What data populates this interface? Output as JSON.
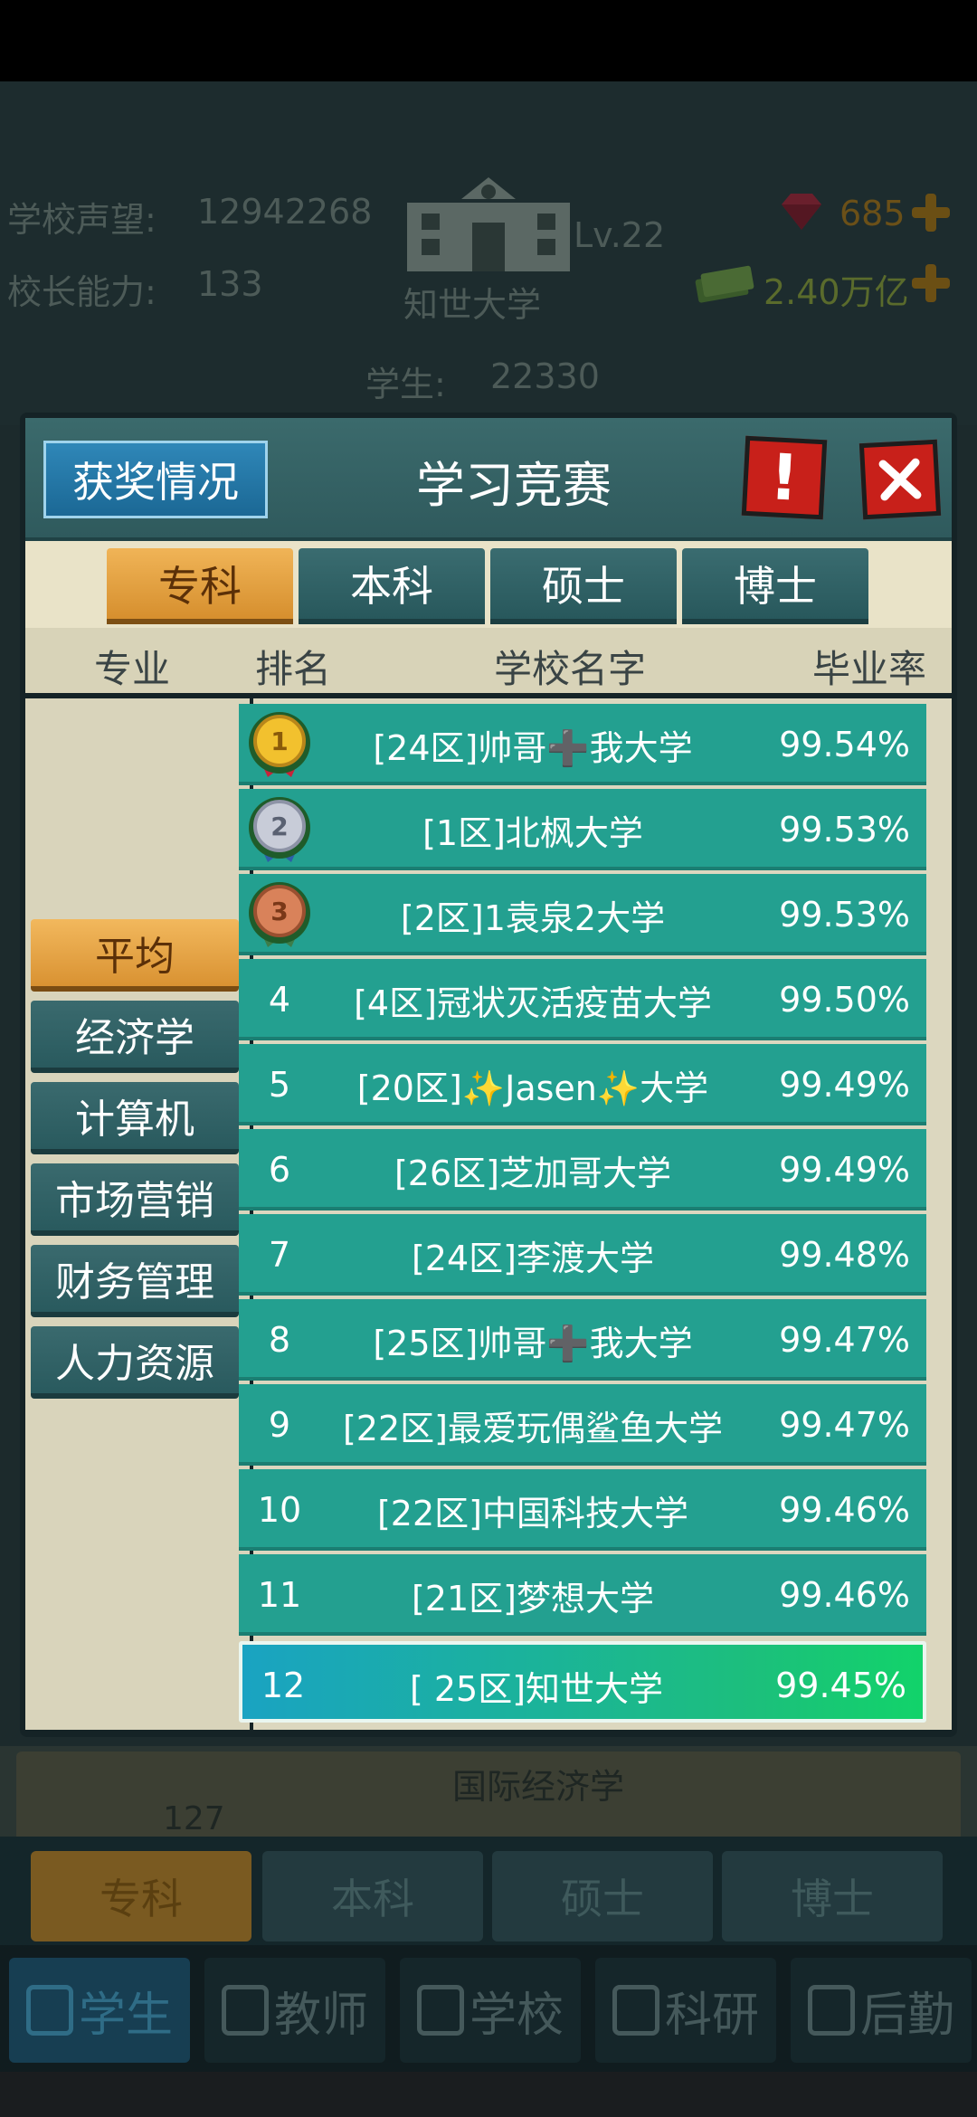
{
  "background": {
    "reputation_label": "学校声望:",
    "reputation_value": "12942268",
    "ability_label": "校长能力:",
    "ability_value": "133",
    "level": "Lv.22",
    "school_name": "知世大学",
    "students_label": "学生:",
    "students_value": "22330",
    "gems": "685",
    "money": "2.40万亿",
    "lower_course": "国际经济学",
    "lower_count": "127",
    "degree_tabs": [
      "专科",
      "本科",
      "硕士",
      "博士"
    ],
    "nav": [
      "学生",
      "教师",
      "学校",
      "科研",
      "后勤"
    ]
  },
  "modal": {
    "title": "学习竞赛",
    "award_button": "获奖情况",
    "alert_symbol": "!",
    "degree_tabs": [
      "专科",
      "本科",
      "硕士",
      "博士"
    ],
    "active_degree": "专科",
    "columns": {
      "major": "专业",
      "rank": "排名",
      "school": "学校名字",
      "rate": "毕业率"
    },
    "majors": [
      "平均",
      "经济学",
      "计算机",
      "市场营销",
      "财务管理",
      "人力资源"
    ],
    "active_major": "平均",
    "rows": [
      {
        "rank": "1",
        "school": "[24区]帅哥➕我大学",
        "rate": "99.54%"
      },
      {
        "rank": "2",
        "school": "[1区]北枫大学",
        "rate": "99.53%"
      },
      {
        "rank": "3",
        "school": "[2区]1袁泉2大学",
        "rate": "99.53%"
      },
      {
        "rank": "4",
        "school": "[4区]冠状灭活疫苗大学",
        "rate": "99.50%"
      },
      {
        "rank": "5",
        "school": "[20区]✨Jasen✨大学",
        "rate": "99.49%"
      },
      {
        "rank": "6",
        "school": "[26区]芝加哥大学",
        "rate": "99.49%"
      },
      {
        "rank": "7",
        "school": "[24区]李渡大学",
        "rate": "99.48%"
      },
      {
        "rank": "8",
        "school": "[25区]帅哥➕我大学",
        "rate": "99.47%"
      },
      {
        "rank": "9",
        "school": "[22区]最爱玩偶鲨鱼大学",
        "rate": "99.47%"
      },
      {
        "rank": "10",
        "school": "[22区]中国科技大学",
        "rate": "99.46%"
      },
      {
        "rank": "11",
        "school": "[21区]梦想大学",
        "rate": "99.46%"
      },
      {
        "rank": "12",
        "school": "[ 25区]知世大学",
        "rate": "99.45%"
      }
    ]
  },
  "colors": {
    "row_teal": "#23a090",
    "active_orange": "#d99232",
    "gold_medal": "#f2c12e",
    "silver_medal": "#c8ccd8",
    "bronze_medal": "#d9825a",
    "close_red": "#c8201a"
  }
}
